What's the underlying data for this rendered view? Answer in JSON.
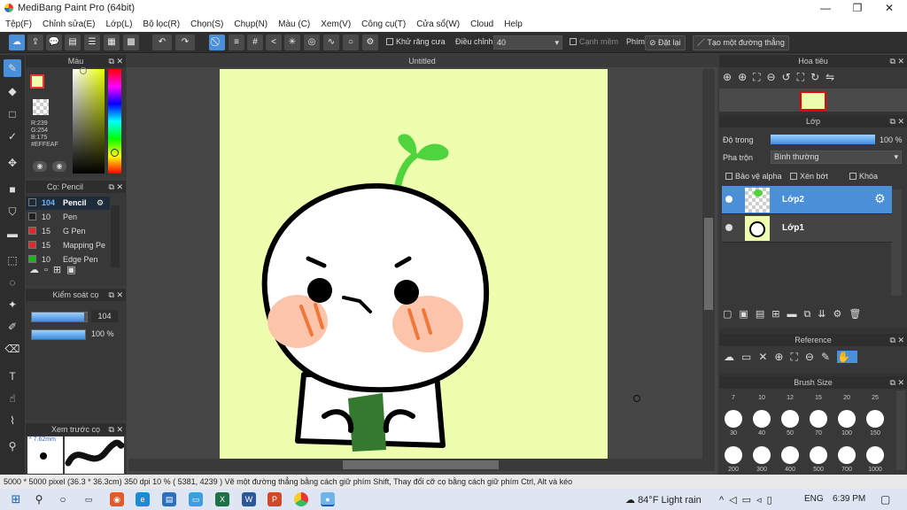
{
  "window": {
    "title": "MediBang Paint Pro (64bit)",
    "minimize": "—",
    "maximize": "❐",
    "close": "✕"
  },
  "menu": [
    "Tệp(F)",
    "Chỉnh sửa(E)",
    "Lớp(L)",
    "Bộ lọc(R)",
    "Chọn(S)",
    "Chụp(N)",
    "Màu (C)",
    "Xem(V)",
    "Công cụ(T)",
    "Cửa sổ(W)",
    "Cloud",
    "Help"
  ],
  "toolbar": {
    "antialias_label": "Khử răng cưa",
    "adjust_label": "Điều chỉnh",
    "adjust_value": "40",
    "soft_edge_label": "Cạnh mềm",
    "key_label": "Phím",
    "reset_label": "Đặt lại",
    "straight_line_label": "Tạo một đường thẳng"
  },
  "color_panel": {
    "title": "Màu",
    "r": "R:239",
    "g": "G:254",
    "b": "B:175",
    "hex": "#EFFEAF",
    "current_color": "#eefeaf"
  },
  "brush_panel": {
    "title": "Cọ: Pencil",
    "items": [
      {
        "size": "104",
        "name": "Pencil",
        "color": "#1e2c3a"
      },
      {
        "size": "10",
        "name": "Pen",
        "color": "#222222"
      },
      {
        "size": "15",
        "name": "G Pen",
        "color": "#e02b2b"
      },
      {
        "size": "15",
        "name": "Mapping Pe",
        "color": "#e02b2b"
      },
      {
        "size": "10",
        "name": "Edge Pen",
        "color": "#1bb51b"
      }
    ]
  },
  "brush_control": {
    "title": "Kiểm soát cọ",
    "size_value": "104",
    "opacity_value": "100 %",
    "size_fill": 0.95,
    "opacity_fill": 1.0
  },
  "brush_preview": {
    "title": "Xem trước cọ",
    "size_text": "* 7.62mm"
  },
  "canvas": {
    "tab_title": "Untitled",
    "background": "#eefeaf"
  },
  "navigator": {
    "title": "Hoa tiêu"
  },
  "layer_panel": {
    "title": "Lớp",
    "opacity_label": "Độ trong",
    "opacity_value": "100 %",
    "blend_label": "Pha trộn",
    "blend_value": "Bình thường",
    "protect_alpha": "Bảo vệ alpha",
    "clipping": "Xén bớt",
    "lock": "Khóa",
    "layers": [
      {
        "name": "Lớp2",
        "selected": true
      },
      {
        "name": "Lớp1",
        "selected": false
      }
    ]
  },
  "reference_panel": {
    "title": "Reference"
  },
  "brush_size_panel": {
    "title": "Brush Size",
    "top_labels": [
      "7",
      "10",
      "12",
      "15",
      "20",
      "25"
    ],
    "row1": [
      "30",
      "40",
      "50",
      "70",
      "100",
      "150"
    ],
    "row2": [
      "200",
      "300",
      "400",
      "500",
      "700",
      "1000"
    ]
  },
  "status": {
    "text": "5000 * 5000 pixel   (36.3 * 36.3cm)   350 dpi   10 %   ( 5381, 4239 )   Vẽ một đường thẳng bằng cách giữ phím Shift, Thay đổi cỡ cọ bằng cách giữ phím Ctrl, Alt và kéo"
  },
  "taskbar": {
    "weather": "84°F  Light rain",
    "lang": "ENG",
    "time": "6:39 PM"
  }
}
